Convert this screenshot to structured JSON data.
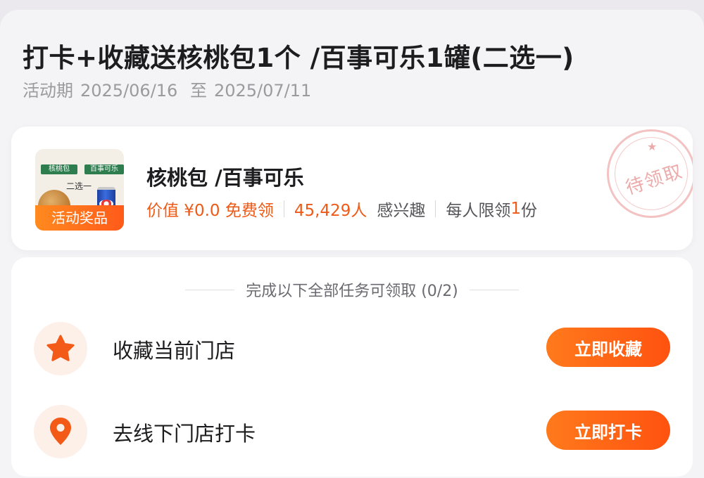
{
  "title": "打卡+收藏送核桃包1个 /百事可乐1罐(二选一)",
  "period": {
    "label": "活动期",
    "start": "2025/06/16",
    "to": "至",
    "end": "2025/07/11"
  },
  "prize": {
    "thumbnail_tags": [
      "核桃包",
      "百事可乐"
    ],
    "thumbnail_choose": "二选一",
    "badge": "活动奖品",
    "name": "核桃包 /百事可乐",
    "value_text": "价值 ¥0.0 免费领",
    "interest_count": "45,429人",
    "interest_label": "感兴趣",
    "limit_prefix": "每人限领",
    "limit_num": "1",
    "limit_suffix": "份",
    "stamp": "待领取"
  },
  "tasks": {
    "header": "完成以下全部任务可领取 (0/2)",
    "items": [
      {
        "icon": "star-icon",
        "label": "收藏当前门店",
        "button": "立即收藏"
      },
      {
        "icon": "location-pin-icon",
        "label": "去线下门店打卡",
        "button": "立即打卡"
      }
    ]
  },
  "colors": {
    "accent": "#ff5a1a",
    "accent_text": "#ee5a17",
    "icon_bg": "#fdf0e9"
  }
}
